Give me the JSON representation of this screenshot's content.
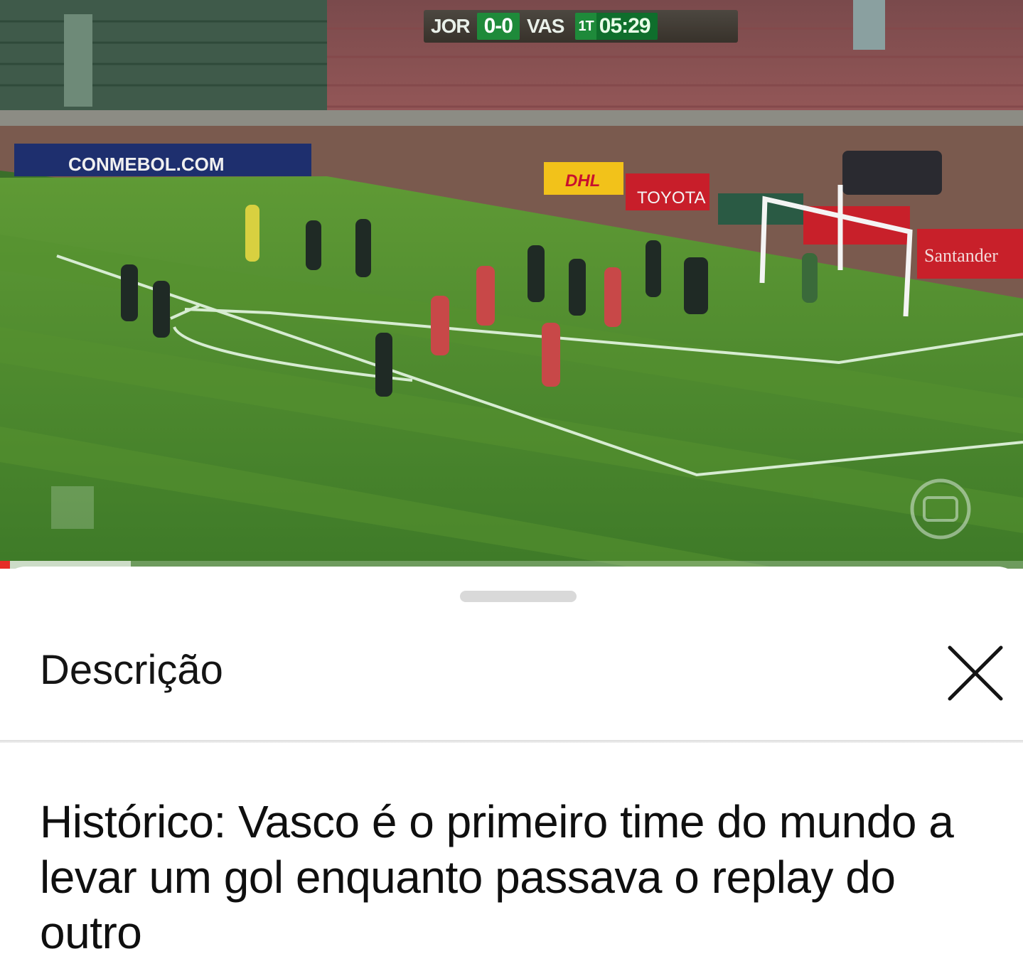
{
  "video": {
    "scoreboard": {
      "home_team": "JOR",
      "score": "0-0",
      "away_team": "VAS",
      "half": "1T",
      "clock": "05:29"
    },
    "ad_boards": {
      "conmebol": "CONMEBOL.COM",
      "dhl": "DHL",
      "toyota": "TOYOTA",
      "santander": "Santander"
    },
    "progress_fraction": 0.01,
    "buffered_fraction": 0.128,
    "colors": {
      "progress": "#e52d27",
      "pitch": "#4f8a2e"
    }
  },
  "sheet": {
    "title": "Descrição",
    "close_icon": "close-icon",
    "description_text": "Histórico: Vasco é o primeiro time do mundo a levar um gol enquanto passava o replay do outro"
  }
}
